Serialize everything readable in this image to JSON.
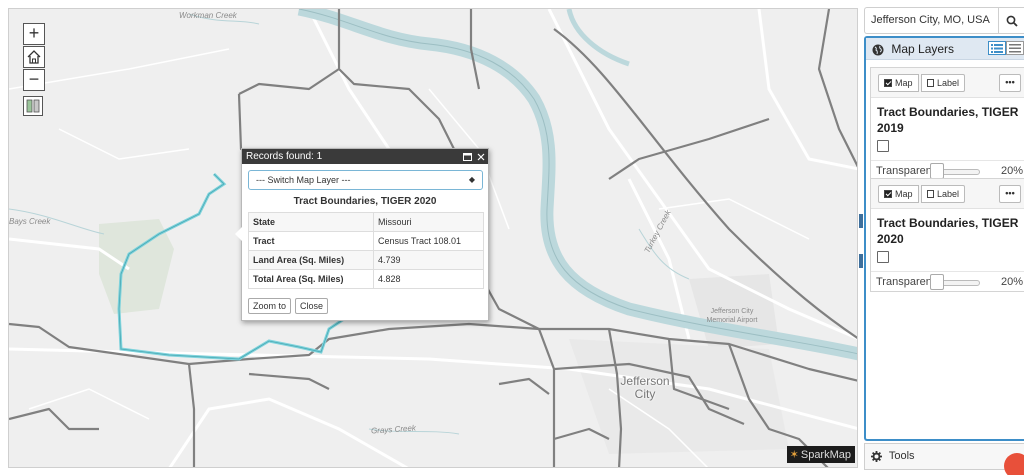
{
  "map": {
    "place_labels": {
      "workman_creek": "Workman Creek",
      "bays_creek": "Bays Creek",
      "grays_creek": "Grays Creek",
      "turkey_creek": "Turkey Creek",
      "airport": "Jefferson City Memorial Airport",
      "city": "Jefferson City"
    },
    "controls": {
      "zoom_in": "+",
      "zoom_out": "−"
    },
    "brand": "SparkMap",
    "colors": {
      "river": "#c5dde0",
      "tract_line": "#7e7e7e",
      "highlight": "#7fd3dc",
      "road": "#ffffff"
    }
  },
  "popup": {
    "header": "Records found: 1",
    "switch_placeholder": "--- Switch Map Layer ---",
    "layer_title": "Tract Boundaries, TIGER 2020",
    "rows": [
      {
        "key": "State",
        "value": "Missouri"
      },
      {
        "key": "Tract",
        "value": "Census Tract 108.01"
      },
      {
        "key": "Land Area (Sq. Miles)",
        "value": "4.739"
      },
      {
        "key": "Total Area (Sq. Miles)",
        "value": "4.828"
      }
    ],
    "zoom_button": "Zoom to",
    "close_button": "Close"
  },
  "panel": {
    "search_value": "Jefferson City, MO, USA",
    "layers_title": "Map Layers",
    "layers": [
      {
        "map_toggle": "Map",
        "label_toggle": "Label",
        "name": "Tract Boundaries, TIGER 2019",
        "transparency_label": "Transparency",
        "transparency_value": "20%",
        "transparency_fraction": 0.2
      },
      {
        "map_toggle": "Map",
        "label_toggle": "Label",
        "name": "Tract Boundaries, TIGER 2020",
        "transparency_label": "Transparency",
        "transparency_value": "20%",
        "transparency_fraction": 0.2
      }
    ],
    "more_label": "•••",
    "tools_label": "Tools"
  }
}
